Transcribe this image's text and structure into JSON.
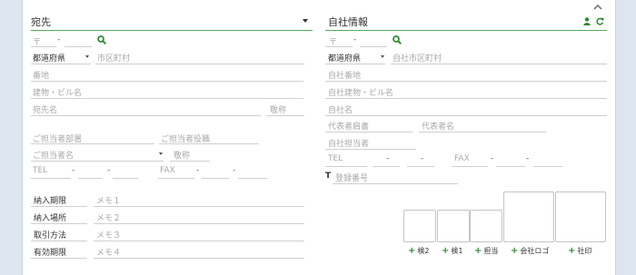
{
  "recipient": {
    "title": "宛先",
    "postal_symbol": "〒",
    "postal_dash": "-",
    "prefecture_placeholder": "都道府県",
    "city_placeholder": "市区町村",
    "address_placeholder": "番地",
    "building_placeholder": "建物・ビル名",
    "name_placeholder": "宛先名",
    "honorific": "敬称",
    "dept_placeholder": "ご担当者部署",
    "position_placeholder": "ご担当者役職",
    "person_placeholder": "ご担当者名",
    "person_honorific": "敬称",
    "tel_label": "TEL",
    "fax_label": "FAX",
    "dash": "-",
    "details": [
      {
        "label": "納入期限",
        "memo": "メモ１"
      },
      {
        "label": "納入場所",
        "memo": "メモ２"
      },
      {
        "label": "取引方法",
        "memo": "メモ３"
      },
      {
        "label": "有効期限",
        "memo": "メモ４"
      }
    ]
  },
  "company": {
    "title": "自社情報",
    "postal_symbol": "〒",
    "postal_dash": "-",
    "prefecture_placeholder": "都道府県",
    "city_placeholder": "自社市区町村",
    "address_placeholder": "自社番地",
    "building_placeholder": "自社建物・ビル名",
    "name_placeholder": "自社名",
    "rep_title_placeholder": "代表者肩書",
    "rep_name_placeholder": "代表者名",
    "staff_placeholder": "自社担当者",
    "tel_label": "TEL",
    "fax_label": "FAX",
    "dash": "-",
    "reg_symbol": "T",
    "reg_placeholder": "登録番号",
    "stamps": [
      {
        "label": "検2"
      },
      {
        "label": "検1"
      },
      {
        "label": "担当"
      },
      {
        "label": "会社ロゴ"
      },
      {
        "label": "社印"
      }
    ]
  },
  "colors": {
    "accent": "#55a95a",
    "icon_green": "#2e8b34"
  },
  "icons": [
    "chevron-up-icon",
    "dropdown-caret-icon",
    "search-icon",
    "user-icon",
    "refresh-icon",
    "plus-icon"
  ]
}
